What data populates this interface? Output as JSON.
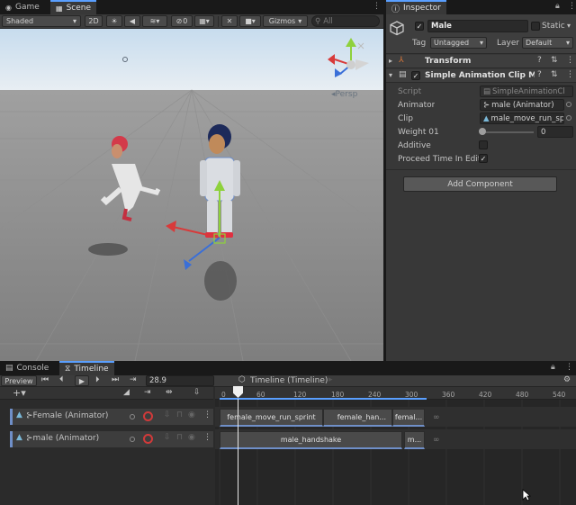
{
  "scene_panel": {
    "tabs": [
      {
        "label": "Game"
      },
      {
        "label": "Scene"
      }
    ],
    "toolbar": {
      "shading_mode": "Shaded",
      "mode_2d": "2D",
      "hidden_count": "0",
      "gizmos_label": "Gizmos",
      "search_placeholder": "All"
    },
    "persp_label": "Persp"
  },
  "inspector": {
    "tab_label": "Inspector",
    "object_name": "Male",
    "static_label": "Static",
    "tag_label": "Tag",
    "tag_value": "Untagged",
    "layer_label": "Layer",
    "layer_value": "Default",
    "components": [
      {
        "name": "Transform"
      },
      {
        "name": "Simple Animation Clip Mixe"
      }
    ],
    "fields": {
      "script_label": "Script",
      "script_value": "SimpleAnimationCl",
      "animator_label": "Animator",
      "animator_value": "male (Animator)",
      "clip_label": "Clip",
      "clip_value": "male_move_run_spr",
      "weight_label": "Weight 01",
      "weight_value": "0",
      "weight_fraction": 0.0,
      "additive_label": "Additive",
      "proceed_label": "Proceed Time In Edit",
      "proceed_checked": "✓"
    },
    "add_component_label": "Add Component"
  },
  "bottom_panel": {
    "tabs": [
      {
        "label": "Console"
      },
      {
        "label": "Timeline"
      }
    ],
    "preview_label": "Preview",
    "current_time": "28.9",
    "asset_label": "Timeline (Timeline)",
    "ruler": [
      "0",
      "60",
      "120",
      "180",
      "240",
      "300",
      "360",
      "420",
      "480",
      "540"
    ],
    "tracks": [
      {
        "binding": "Female (Animator)",
        "clips": [
          {
            "label": "female_move_run_sprint"
          },
          {
            "label": "female_han..."
          },
          {
            "label": "femal..."
          }
        ]
      },
      {
        "binding": "male (Animator)",
        "clips": [
          {
            "label": "male_handshake"
          },
          {
            "label": "m..."
          }
        ]
      }
    ]
  },
  "colors": {
    "accent": "#5a9fff",
    "record": "#d03a3a",
    "track_accent": "#6f8fc8",
    "gizmo_y": "#8ed13c",
    "gizmo_x": "#d83a3a",
    "gizmo_z": "#3a6fd8"
  }
}
